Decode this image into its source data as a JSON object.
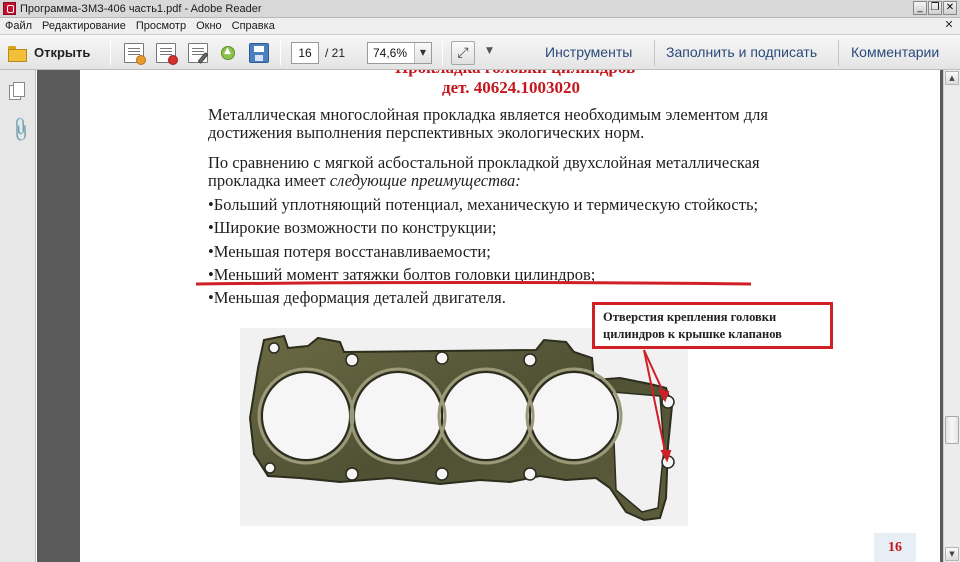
{
  "window": {
    "title": "Программа-ЗМЗ-406 часть1.pdf - Adobe Reader",
    "controls": [
      "_",
      "❐",
      "✕"
    ]
  },
  "menu": {
    "items": [
      "Файл",
      "Редактирование",
      "Просмотр",
      "Окно",
      "Справка"
    ],
    "close_glyph": "✕"
  },
  "toolbar": {
    "open_label": "Открыть",
    "icons": [
      "folder-icon",
      "create-pdf-icon",
      "convert-icon",
      "edit-icon",
      "upload-icon",
      "save-icon"
    ],
    "page_current": "16",
    "page_total": "/ 21",
    "zoom": "74,6%",
    "tabs": [
      "Инструменты",
      "Заполнить и подписать",
      "Комментарии"
    ]
  },
  "document": {
    "title_cut": "Прокладка головки цилиндров",
    "subtitle": "дет. 40624.1003020",
    "para1_line1": "Металлическая многослойная прокладка является необходимым элементом для",
    "para1_line2": "достижения выполнения перспективных экологических норм.",
    "para2_line1": "По сравнению с мягкой асбостальной прокладкой двухслойная металлическая",
    "para2_line2_prefix": "прокладка имеет ",
    "para2_line2_italic": "следующие преимущества:",
    "bullets": [
      "•Больший уплотняющий потенциал, механическую и термическую стойкость;",
      "•Широкие возможности по конструкции;",
      "•Меньшая потеря восстанавливаемости;",
      "•Меньший момент затяжки болтов головки цилиндров;",
      "•Меньшая деформация деталей двигателя."
    ],
    "callout": {
      "line1": "Отверстия крепления головки",
      "line2": "цилиндров к крышке клапанов"
    },
    "page_number": "16",
    "accent_color": "#c4161c"
  }
}
